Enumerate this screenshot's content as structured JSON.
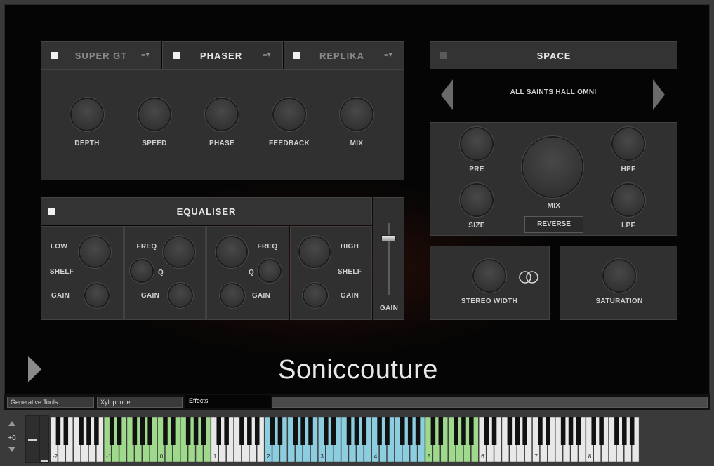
{
  "fx_tabs": [
    {
      "label": "SUPER GT",
      "active": false,
      "menu": "≡▾"
    },
    {
      "label": "PHASER",
      "active": true,
      "menu": "≡▾"
    },
    {
      "label": "REPLIKA",
      "active": false,
      "menu": "≡▾"
    }
  ],
  "phaser": {
    "knobs": [
      {
        "label": "DEPTH",
        "value": 0.35
      },
      {
        "label": "SPEED",
        "value": 0.22
      },
      {
        "label": "PHASE",
        "value": 0.5
      },
      {
        "label": "FEEDBACK",
        "value": 0.3
      },
      {
        "label": "MIX",
        "value": 0.4
      }
    ]
  },
  "equaliser": {
    "title": "EQUALISER",
    "bands": [
      {
        "top_label": "LOW",
        "mid_label": "SHELF",
        "gain_label": "GAIN",
        "main_value": 0.65,
        "gain_value": 0.5
      },
      {
        "top_label": "FREQ",
        "q_label": "Q",
        "gain_label": "GAIN",
        "main_value": 0.55,
        "q_value": 0.0,
        "gain_value": 0.55
      },
      {
        "top_label": "FREQ",
        "q_label": "Q",
        "gain_label": "GAIN",
        "main_value": 0.45,
        "q_value": 0.0,
        "gain_value": 0.5
      },
      {
        "top_label": "HIGH",
        "mid_label": "SHELF",
        "gain_label": "GAIN",
        "main_value": 0.45,
        "gain_value": 0.5
      }
    ],
    "output_gain_label": "GAIN",
    "output_gain_value": 0.78
  },
  "space": {
    "title": "SPACE",
    "preset": "ALL SAINTS HALL OMNI",
    "knobs": {
      "pre": {
        "label": "PRE",
        "value": 0.0
      },
      "hpf": {
        "label": "HPF",
        "value": 0.0
      },
      "size": {
        "label": "SIZE",
        "value": 0.5
      },
      "lpf": {
        "label": "LPF",
        "value": 0.92
      },
      "mix": {
        "label": "MIX",
        "value": 0.85
      }
    },
    "reverse_label": "REVERSE"
  },
  "stereo_width": {
    "label": "STEREO WIDTH",
    "value": 0.5
  },
  "saturation": {
    "label": "SATURATION",
    "value": 0.0
  },
  "brand": "Soniccouture",
  "bottom_tabs": [
    {
      "label": "Generative Tools",
      "active": false
    },
    {
      "label": "Xylophone",
      "active": false
    },
    {
      "label": "Effects",
      "active": true
    }
  ],
  "keyboard": {
    "transpose": "+0",
    "octave_labels": [
      "-2",
      "-1",
      "0",
      "1",
      "2",
      "3",
      "4",
      "5",
      "6",
      "7",
      "8"
    ],
    "colors": {
      "green": "#9ed98c",
      "blue": "#8ccde0",
      "white": "#e8e8e8",
      "black": "#111111"
    },
    "green_octaves": [
      1,
      2
    ],
    "blue_octaves": [
      4,
      5,
      6
    ],
    "green_octaves_2": [
      7
    ]
  },
  "colors": {
    "arc": "#f2f2f2",
    "panel": "#303030",
    "frame": "#050505"
  }
}
